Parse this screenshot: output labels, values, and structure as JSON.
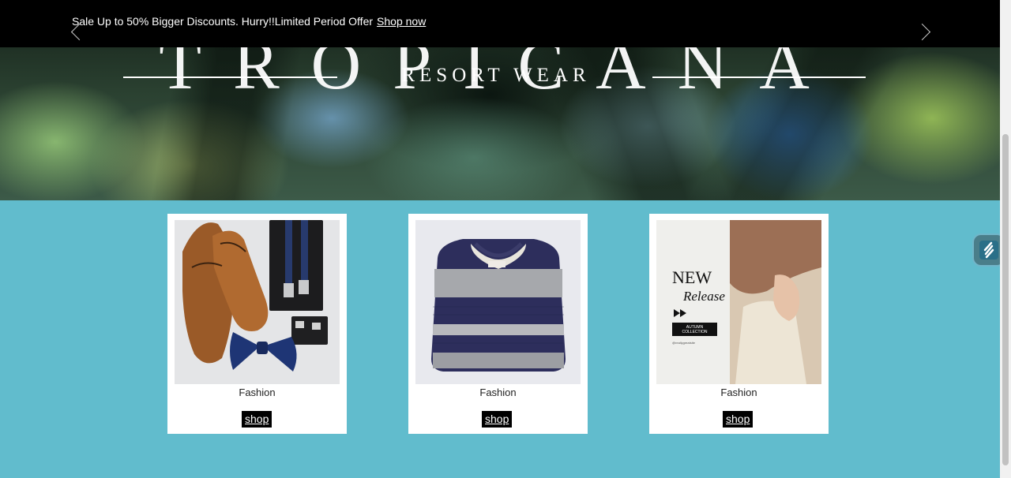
{
  "announcement": {
    "text": "Sale Up to 50% Bigger Discounts. Hurry!!Limited Period Offer",
    "link_label": "Shop now",
    "prev_icon": "chevron-left-icon",
    "next_icon": "chevron-right-icon"
  },
  "hero": {
    "wordmark": "TROPICANA",
    "subtitle": "RESORT WEAR"
  },
  "products": [
    {
      "label": "Fashion",
      "button": "shop",
      "image": "shoes-suspenders-bowtie-photo"
    },
    {
      "label": "Fashion",
      "button": "shop",
      "image": "striped-sweater-photo"
    },
    {
      "label": "Fashion",
      "button": "shop",
      "image": "new-release-promo-photo",
      "promo": {
        "title": "NEW",
        "script": "Release",
        "badge_line1": "AUTUMN",
        "badge_line2": "COLLECTION",
        "handle": "@reallygreatsite"
      }
    }
  ],
  "colors": {
    "page_background": "#61bccd",
    "announcement_background": "#000000",
    "button_background": "#000000",
    "card_background": "#ffffff"
  },
  "widget": {
    "icon": "lightning-s-icon"
  }
}
